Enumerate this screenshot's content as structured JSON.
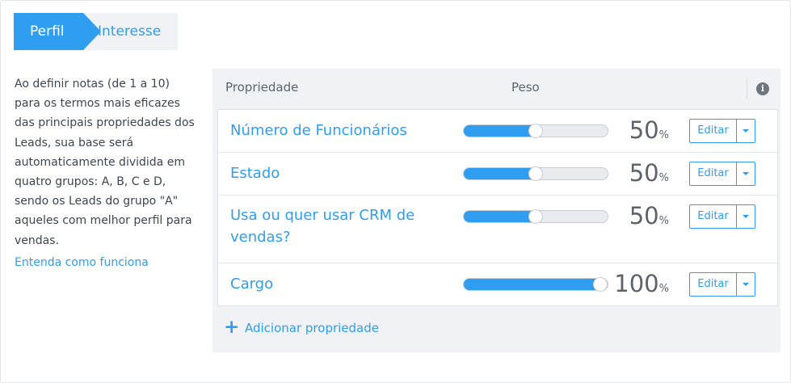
{
  "tabs": [
    {
      "label": "Perfil",
      "active": true
    },
    {
      "label": "Interesse",
      "active": false
    }
  ],
  "description": "Ao definir notas (de 1 a 10) para os termos mais eficazes das principais propriedades dos Leads, sua base será automaticamente dividida em quatro grupos: A, B, C e D, sendo os Leads do grupo \"A\" aqueles com melhor perfil para vendas.",
  "learn_more": "Entenda como funciona",
  "table": {
    "header_property": "Propriedade",
    "header_weight": "Peso",
    "info_icon": "info-icon",
    "rows": [
      {
        "label": "Número de Funcionários",
        "weight": 50,
        "percent_label": "50",
        "percent_symbol": "%",
        "edit_label": "Editar"
      },
      {
        "label": "Estado",
        "weight": 50,
        "percent_label": "50",
        "percent_symbol": "%",
        "edit_label": "Editar"
      },
      {
        "label": "Usa ou quer usar CRM de vendas?",
        "weight": 50,
        "percent_label": "50",
        "percent_symbol": "%",
        "edit_label": "Editar"
      },
      {
        "label": "Cargo",
        "weight": 100,
        "percent_label": "100",
        "percent_symbol": "%",
        "edit_label": "Editar"
      }
    ]
  },
  "add_property": {
    "icon": "plus-icon",
    "label": "Adicionar propriedade"
  },
  "colors": {
    "accent": "#2f9df0",
    "panel": "#f0f2f5",
    "track": "#e9ebee"
  }
}
